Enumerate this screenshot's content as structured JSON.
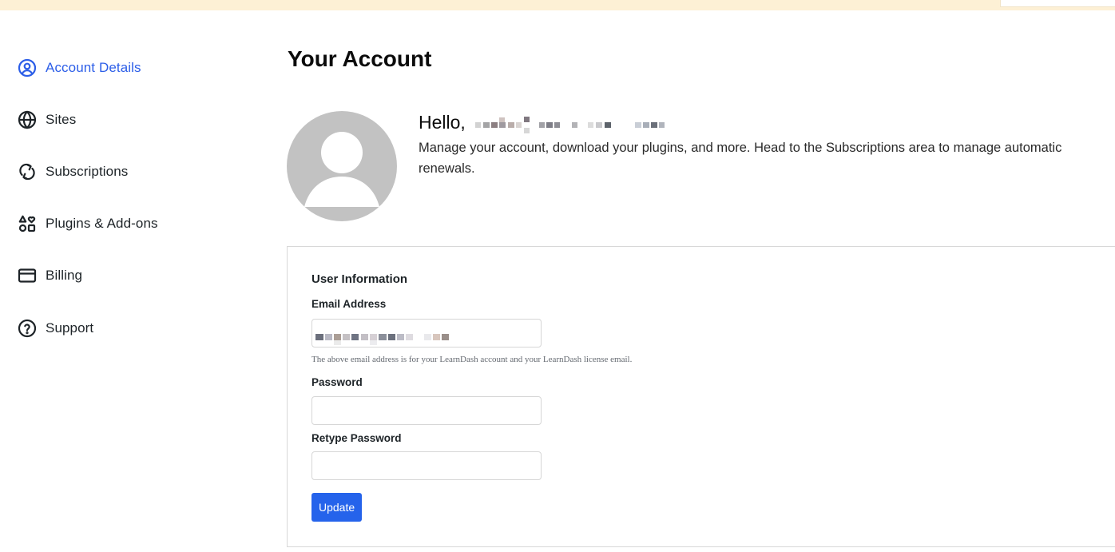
{
  "nav": {
    "items": [
      {
        "label": "Account Details",
        "icon": "user-circle-icon",
        "active": true
      },
      {
        "label": "Sites",
        "icon": "globe-icon",
        "active": false
      },
      {
        "label": "Subscriptions",
        "icon": "refresh-icon",
        "active": false
      },
      {
        "label": "Plugins & Add-ons",
        "icon": "shapes-icon",
        "active": false
      },
      {
        "label": "Billing",
        "icon": "credit-card-icon",
        "active": false
      },
      {
        "label": "Support",
        "icon": "help-circle-icon",
        "active": false
      }
    ]
  },
  "main": {
    "title": "Your Account",
    "greeting": "Hello,",
    "intro": "Manage your account, download your plugins, and more. Head to the Subscriptions area to manage automatic renewals."
  },
  "form": {
    "section_title": "User Information",
    "email_label": "Email Address",
    "email_help": "The above email address is for your LearnDash account and your LearnDash license email.",
    "password_label": "Password",
    "password_value": "",
    "retype_label": "Retype Password",
    "retype_value": "",
    "update_label": "Update"
  },
  "colors": {
    "accent": "#2c5ee8",
    "button": "#2563eb",
    "notice": "#fdf0d5",
    "avatar": "#c2c2c2"
  }
}
